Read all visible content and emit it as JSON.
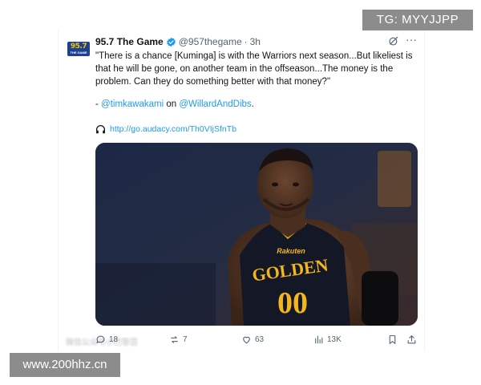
{
  "account": {
    "display_name": "95.7 The Game",
    "handle": "@957thegame",
    "separator": "·",
    "time": "3h",
    "avatar_logo_num": "95.7",
    "avatar_logo_sub": "THE GAME"
  },
  "tweet": {
    "text": "\"There is a chance [Kuminga] is with the Warriors next season...But likeliest is that he will be gone, on another team in the offseason...The money is the problem. Can they do something better with that money?\"",
    "attrib_prefix": "- ",
    "mention_1": "@timkawakami",
    "attrib_middle": " on ",
    "mention_2": "@WillardAndDibs",
    "attrib_suffix": ".",
    "link_url": "http://go.audacy.com/Th0VIjSfnTb"
  },
  "media": {
    "jersey_line1": "GOLDEN",
    "jersey_number": "00",
    "jersey_sponsor": "Rakuten"
  },
  "actions": {
    "replies": "18",
    "reposts": "7",
    "likes": "63",
    "views": "13K"
  },
  "watermarks": {
    "top": "TG: MYYJJPP",
    "bottom": "www.200hhz.cn",
    "faint": "微信公众号小巴黎百"
  },
  "colors": {
    "link": "#1d9bf0",
    "verified": "#1d9bf0",
    "secondary_text": "#536471"
  },
  "icons": [
    "verified-badge-icon",
    "grok-icon",
    "more-icon",
    "headphones-icon",
    "reply-icon",
    "repost-icon",
    "like-icon",
    "views-icon",
    "bookmark-icon",
    "share-icon"
  ]
}
